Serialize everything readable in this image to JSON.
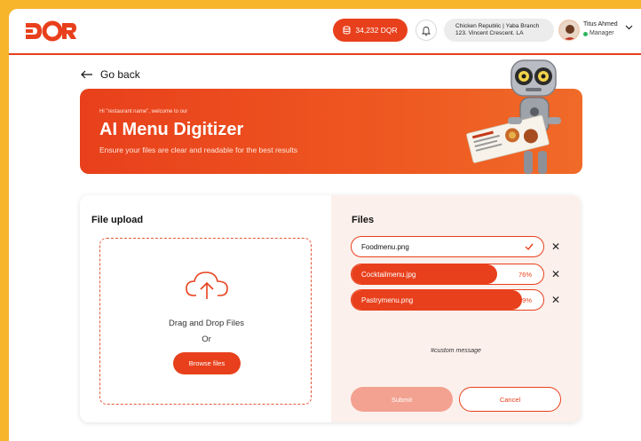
{
  "header": {
    "logo_text": "DQR",
    "balance_label": "34,232 DQR",
    "branch_line1": "Chicken Republic | Yaba Branch",
    "branch_line2": "123. Vincent Crescent. LA",
    "user_name": "Titus Ahmed",
    "user_role": "Manager"
  },
  "nav": {
    "go_back": "Go back"
  },
  "banner": {
    "greeting": "Hi \"restaurant name\", welcome to our",
    "title": "AI Menu Digitizer",
    "subtitle": "Ensure your files are clear and readable for the best results"
  },
  "upload": {
    "title": "File upload",
    "drag_text": "Drag and Drop Files",
    "or_text": "Or",
    "browse_label": "Browse files"
  },
  "files": {
    "title": "Files",
    "items": [
      {
        "name": "Foodmenu.png",
        "progress": 100,
        "status": "complete",
        "percent_label": ""
      },
      {
        "name": "Cocktailmenu.jpg",
        "progress": 76,
        "status": "uploading",
        "percent_label": "76%"
      },
      {
        "name": "Pastrymenu.png",
        "progress": 89,
        "status": "uploading",
        "percent_label": "89%"
      }
    ],
    "custom_message": "#custom message",
    "submit_label": "Submit",
    "cancel_label": "Cancel"
  },
  "colors": {
    "accent": "#e8401c",
    "background": "#f6b52a",
    "success": "#2db55d",
    "submit_disabled": "#f3a190"
  }
}
